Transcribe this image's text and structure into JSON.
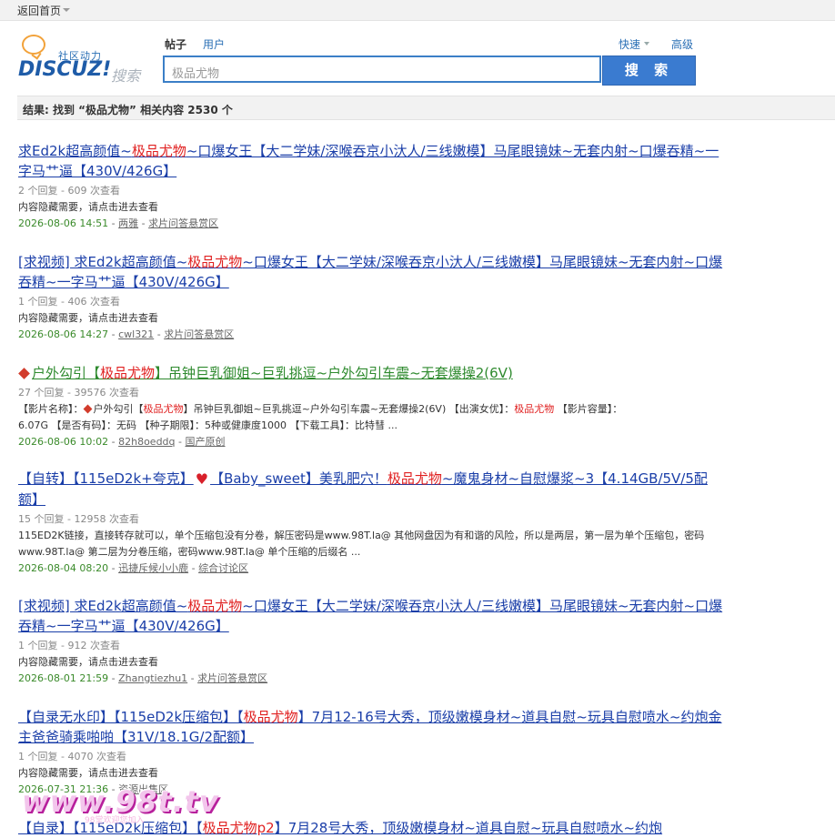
{
  "topbar": {
    "home": "返回首页"
  },
  "logo": {
    "slogan": "社区动力",
    "word": "DISCUZ!",
    "search_word": "搜索"
  },
  "tabs": [
    {
      "label": "帖子",
      "active": true
    },
    {
      "label": "用户",
      "active": false
    }
  ],
  "options": {
    "quick": "快速",
    "advanced": "高级"
  },
  "search": {
    "value": "极品尤物",
    "button": "搜 索"
  },
  "result_summary": "结果: 找到 “极品尤物” 相关内容 2530 个",
  "results": [
    {
      "title_pre": "求Ed2k超高颜值~",
      "title_hl": "极品尤物",
      "title_post": "~口爆女王【大二学妹/深喉吞京小汏人/三线嫩模】马尾眼镜妹~无套内射~口爆吞精~一字马艹逼【430V/426G】",
      "meta": "2 个回复 - 609 次查看",
      "snippet": "内容隐藏需要，请点击进去查看",
      "date": "2026-08-06 14:51",
      "user": "两雅",
      "forum": "求片问答悬赏区"
    },
    {
      "title_pre": "[求视频] 求Ed2k超高颜值~",
      "title_hl": "极品尤物",
      "title_post": "~口爆女王【大二学妹/深喉吞京小汏人/三线嫩模】马尾眼镜妹~无套内射~口爆吞精~一字马艹逼【430V/426G】",
      "meta": "1 个回复 - 406 次查看",
      "snippet": "内容隐藏需要，请点击进去查看",
      "date": "2026-08-06 14:27",
      "user": "cwl321",
      "forum": "求片问答悬赏区"
    },
    {
      "title_pre": "户外勾引【",
      "title_hl": "极品尤物",
      "title_post": "】吊钟巨乳御姐~巨乳挑逗~户外勾引车震~无套爆操2(6V)",
      "meta": "27 个回复 - 39576 次查看",
      "snippet_a": "【影片名称】：",
      "snippet_b": "户外勾引【",
      "snippet_hl": "极品尤物",
      "snippet_c": "】吊钟巨乳御姐~巨乳挑逗~户外勾引车震~无套爆操2(6V) 【出演女优】：",
      "snippet_hl2": "极品尤物",
      "snippet_d": " 【影片容量】：",
      "snippet_line2": "6.07G 【是否有码】：无码 【种子期限】：5种或健康度1000 【下载工具】：比特彗 ...",
      "date": "2026-08-06 10:02",
      "user": "82h8oeddq",
      "forum": "国产原创"
    },
    {
      "title_pre": "【自转】【115eD2k+夸克】",
      "title_mid": "【Baby_sweet】美乳肥穴！",
      "title_hl": "极品尤物",
      "title_post": "~魔鬼身材~自慰爆浆~3【4.14GB/5V/5配额】",
      "meta": "15 个回复 - 12958 次查看",
      "snippet": "115ED2K链接，直接转存就可以，单个压缩包没有分卷，解压密码是www.98T.la@ 其他网盘因为有和谐的风险，所以是两层，第一层为单个压缩包，密码www.98T.la@ 第二层为分卷压缩，密码www.98T.la@ 单个压缩的后缀名 ...",
      "date": "2026-08-04 08:20",
      "user": "迅捷斥候小小鹿",
      "forum": "综合讨论区"
    },
    {
      "title_pre": "[求视频] 求Ed2k超高颜值~",
      "title_hl": "极品尤物",
      "title_post": "~口爆女王【大二学妹/深喉吞京小汏人/三线嫩模】马尾眼镜妹~无套内射~口爆吞精~一字马艹逼【430V/426G】",
      "meta": "1 个回复 - 912 次查看",
      "snippet": "内容隐藏需要，请点击进去查看",
      "date": "2026-08-01 21:59",
      "user": "Zhangtiezhu1",
      "forum": "求片问答悬赏区"
    },
    {
      "title_pre": "【自录无水印】【115eD2k压缩包】【",
      "title_hl": "极品尤物",
      "title_post": "】7月12-16号大秀，顶级嫩模身材~道具自慰~玩具自慰喷水~约炮金主爸爸骑乘啪啪【31V/18.1G/2配额】",
      "meta": "1 个回复 - 4070 次查看",
      "snippet": "内容隐藏需要，请点击进去查看",
      "date": "2026-07-31 21:36",
      "user": "",
      "forum": "资源出售区"
    },
    {
      "title_pre": "【自录】【115eD2k压缩包】【",
      "title_hl": "极品尤物p2",
      "title_post": "】7月28号大秀，顶级嫩模身材~道具自慰~玩具自慰喷水~约炮"
    }
  ],
  "watermark": {
    "text": "www.98t.tv",
    "sub": "98堂欢迎您加入"
  },
  "colors": {
    "link": "#1a3ea8",
    "highlight": "#e02020",
    "green": "#2e8a2e",
    "button": "#3a7bd0"
  }
}
